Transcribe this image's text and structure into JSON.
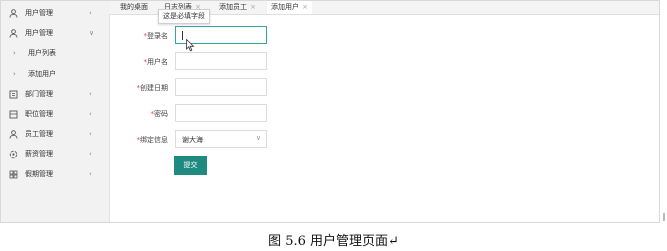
{
  "sidebar": {
    "items": [
      {
        "label": "用户管理",
        "icon": "user-icon",
        "expanded": false
      },
      {
        "label": "用户管理",
        "icon": "user-icon",
        "expanded": true
      },
      {
        "label": "用户列表",
        "sub": true
      },
      {
        "label": "添加用户",
        "sub": true
      },
      {
        "label": "部门管理",
        "icon": "department-icon"
      },
      {
        "label": "职位管理",
        "icon": "position-icon"
      },
      {
        "label": "员工管理",
        "icon": "employee-icon"
      },
      {
        "label": "薪资管理",
        "icon": "salary-icon"
      },
      {
        "label": "假期管理",
        "icon": "holiday-icon"
      }
    ]
  },
  "tabs": [
    {
      "label": "我的桌面",
      "closable": false
    },
    {
      "label": "日志列表",
      "closable": true
    },
    {
      "label": "添加员工",
      "closable": true
    },
    {
      "label": "添加用户",
      "closable": true,
      "active": true
    }
  ],
  "tooltip": "这是必填字段",
  "form": {
    "login_label": "登录名",
    "username_label": "用户名",
    "created_label": "创建日期",
    "password_label": "密码",
    "bind_label": "绑定信息",
    "bind_value": "谢大海",
    "submit_label": "提交",
    "required_mark": "*"
  },
  "caption": "图 5.6  用户管理页面↵",
  "colors": {
    "accent": "#1f8a80",
    "required": "#e43b3b",
    "focus": "#3aa3a0"
  }
}
